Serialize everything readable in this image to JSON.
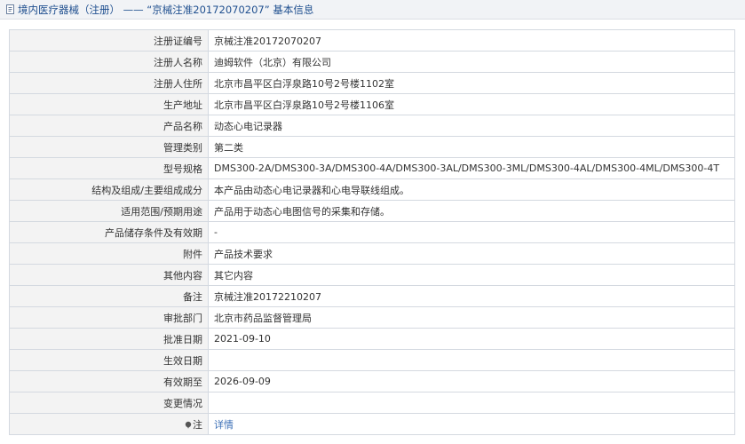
{
  "header": {
    "title": "境内医疗器械（注册） —— “京械注准20172070207” 基本信息"
  },
  "rows": [
    {
      "label": "注册证编号",
      "value": "京械注准20172070207"
    },
    {
      "label": "注册人名称",
      "value": "迪姆软件（北京）有限公司"
    },
    {
      "label": "注册人住所",
      "value": "北京市昌平区白浮泉路10号2号楼1102室"
    },
    {
      "label": "生产地址",
      "value": "北京市昌平区白浮泉路10号2号楼1106室"
    },
    {
      "label": "产品名称",
      "value": "动态心电记录器"
    },
    {
      "label": "管理类别",
      "value": "第二类"
    },
    {
      "label": "型号规格",
      "value": "DMS300-2A/DMS300-3A/DMS300-4A/DMS300-3AL/DMS300-3ML/DMS300-4AL/DMS300-4ML/DMS300-4T"
    },
    {
      "label": "结构及组成/主要组成成分",
      "value": "本产品由动态心电记录器和心电导联线组成。"
    },
    {
      "label": "适用范围/预期用途",
      "value": "产品用于动态心电图信号的采集和存储。"
    },
    {
      "label": "产品储存条件及有效期",
      "value": "-"
    },
    {
      "label": "附件",
      "value": "产品技术要求"
    },
    {
      "label": "其他内容",
      "value": "其它内容"
    },
    {
      "label": "备注",
      "value": "京械注准20172210207"
    },
    {
      "label": "审批部门",
      "value": "北京市药品监督管理局"
    },
    {
      "label": "批准日期",
      "value": "2021-09-10"
    },
    {
      "label": "生效日期",
      "value": ""
    },
    {
      "label": "有效期至",
      "value": "2026-09-09"
    },
    {
      "label": "变更情况",
      "value": ""
    }
  ],
  "note_row": {
    "label": "注",
    "icon": "info-dot-icon",
    "link_text": "详情"
  },
  "colors": {
    "title_text": "#1f4f8f",
    "link": "#3b6fb6",
    "label_bg": "#f3f3f3",
    "border": "#d4d9e0"
  }
}
